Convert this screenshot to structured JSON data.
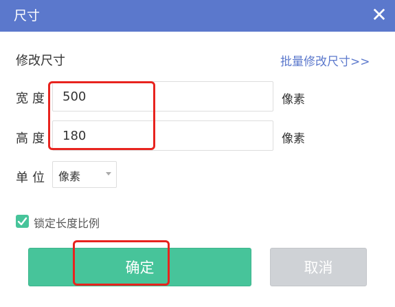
{
  "dialog": {
    "title": "尺寸",
    "close_icon": "close-icon"
  },
  "resize": {
    "section_title": "修改尺寸",
    "batch_link": "批量修改尺寸>>",
    "width": {
      "label": "宽度",
      "value": "500",
      "unit": "像素"
    },
    "height": {
      "label": "高度",
      "value": "180",
      "unit": "像素"
    },
    "unit": {
      "label": "单位",
      "selected": "像素"
    },
    "lock_ratio": {
      "label": "锁定长度比例",
      "checked": true
    }
  },
  "buttons": {
    "confirm": "确定",
    "cancel": "取消"
  },
  "colors": {
    "titlebar": "#5b78cc",
    "confirm": "#47c49a",
    "cancel": "#cfd2d6",
    "annotation": "#e8231e"
  }
}
